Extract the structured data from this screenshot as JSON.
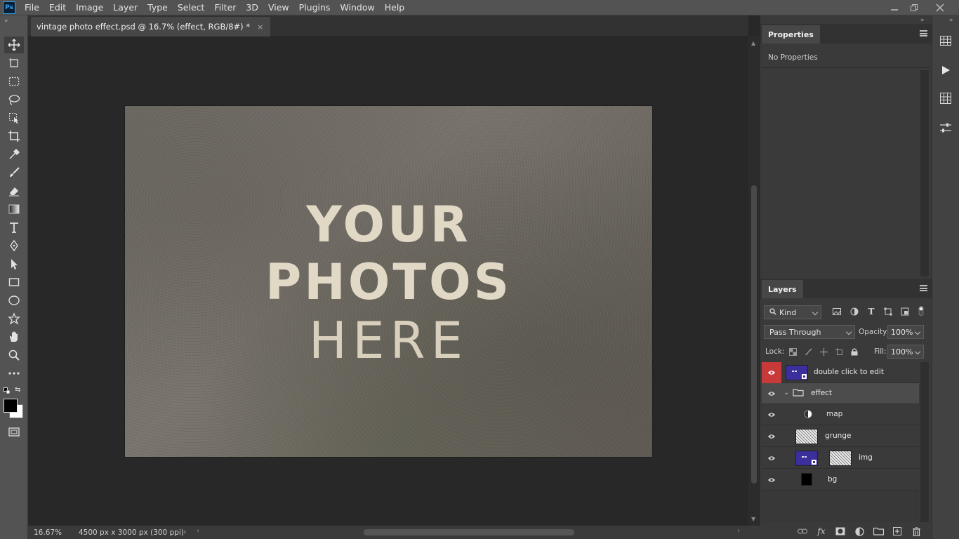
{
  "app": {
    "logo": "Ps",
    "menu": [
      "File",
      "Edit",
      "Image",
      "Layer",
      "Type",
      "Select",
      "Filter",
      "3D",
      "View",
      "Plugins",
      "Window",
      "Help"
    ]
  },
  "window_controls": {
    "minimize": "minimize-icon",
    "restore": "restore-icon",
    "close": "close-icon"
  },
  "document": {
    "tab_title": "vintage photo effect.psd @ 16.7% (effect, RGB/8#) *",
    "close_glyph": "×"
  },
  "artwork": {
    "line1": "YOUR",
    "line2": "PHOTOS",
    "line3": "HERE"
  },
  "status": {
    "zoom": "16.67%",
    "doc_info": "4500 px x 3000 px (300 ppi)"
  },
  "tools": [
    "move-tool-icon",
    "artboard-tool-icon",
    "marquee-tool-icon",
    "lasso-tool-icon",
    "object-select-tool-icon",
    "crop-tool-icon",
    "eyedropper-tool-icon",
    "brush-tool-icon",
    "eraser-tool-icon",
    "gradient-tool-icon",
    "type-tool-icon",
    "pen-tool-icon",
    "path-select-tool-icon",
    "rectangle-tool-icon",
    "ellipse-tool-icon",
    "custom-shape-tool-icon",
    "hand-tool-icon",
    "zoom-tool-icon",
    "more-tools-icon"
  ],
  "colors": {
    "foreground": "#000000",
    "background": "#ffffff",
    "accent_red": "#c8393a",
    "smart_object": "#3a2f9c"
  },
  "properties_panel": {
    "tab": "Properties",
    "message": "No Properties"
  },
  "layers_panel": {
    "tab": "Layers",
    "filter_kind": "Kind",
    "blend_mode": "Pass Through",
    "opacity_label": "Opacity:",
    "opacity_value": "100%",
    "lock_label": "Lock:",
    "fill_label": "Fill:",
    "fill_value": "100%",
    "layers": [
      {
        "name": "double click to edit",
        "type": "smart-object",
        "highlight": true
      },
      {
        "name": "effect",
        "type": "group",
        "selected": true
      },
      {
        "name": "map",
        "type": "adjustment"
      },
      {
        "name": "grunge",
        "type": "pixel"
      },
      {
        "name": "img",
        "type": "smart-object-with-mask"
      },
      {
        "name": "bg",
        "type": "fill"
      }
    ]
  }
}
